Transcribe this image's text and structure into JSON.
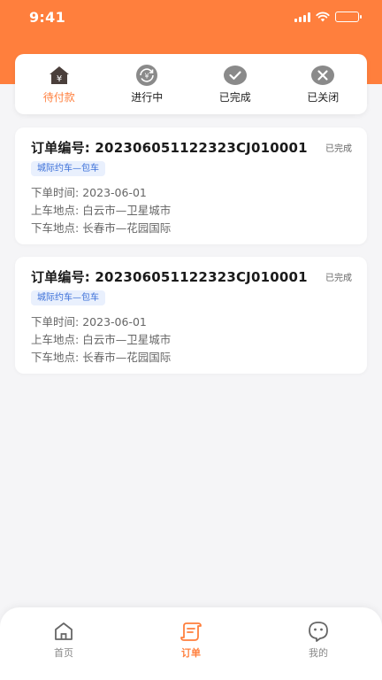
{
  "status_bar": {
    "time": "9:41"
  },
  "tabs": [
    {
      "label": "待付款",
      "icon": "house-yen-icon",
      "active": true
    },
    {
      "label": "进行中",
      "icon": "refresh-yen-icon",
      "active": false
    },
    {
      "label": "已完成",
      "icon": "check-circle-icon",
      "active": false
    },
    {
      "label": "已关闭",
      "icon": "close-circle-icon",
      "active": false
    }
  ],
  "orders": [
    {
      "order_no": "订单编号: 20230605112232​3CJ010001",
      "status": "已完成",
      "tag": "城际约车—包车",
      "rows": [
        {
          "label": "下单时间:",
          "value": "2023-06-01"
        },
        {
          "label": "上车地点:",
          "value": "白云市—卫星城市"
        },
        {
          "label": "下车地点:",
          "value": "长春市—花园国际"
        }
      ]
    },
    {
      "order_no": "订单编号: 202306051122323CJ010001",
      "status": "已完成",
      "tag": "城际约车—包车",
      "rows": [
        {
          "label": "下单时间:",
          "value": "2023-06-01"
        },
        {
          "label": "上车地点:",
          "value": "白云市—卫星城市"
        },
        {
          "label": "下车地点:",
          "value": "长春市—花园国际"
        }
      ]
    }
  ],
  "bottom_nav": [
    {
      "label": "首页",
      "icon": "home-icon",
      "active": false
    },
    {
      "label": "订单",
      "icon": "order-scroll-icon",
      "active": true
    },
    {
      "label": "我的",
      "icon": "profile-face-icon",
      "active": false
    }
  ],
  "colors": {
    "brand": "#ff7f3d",
    "tag_text": "#3b6fd8",
    "tag_bg": "#e9f0fd"
  }
}
